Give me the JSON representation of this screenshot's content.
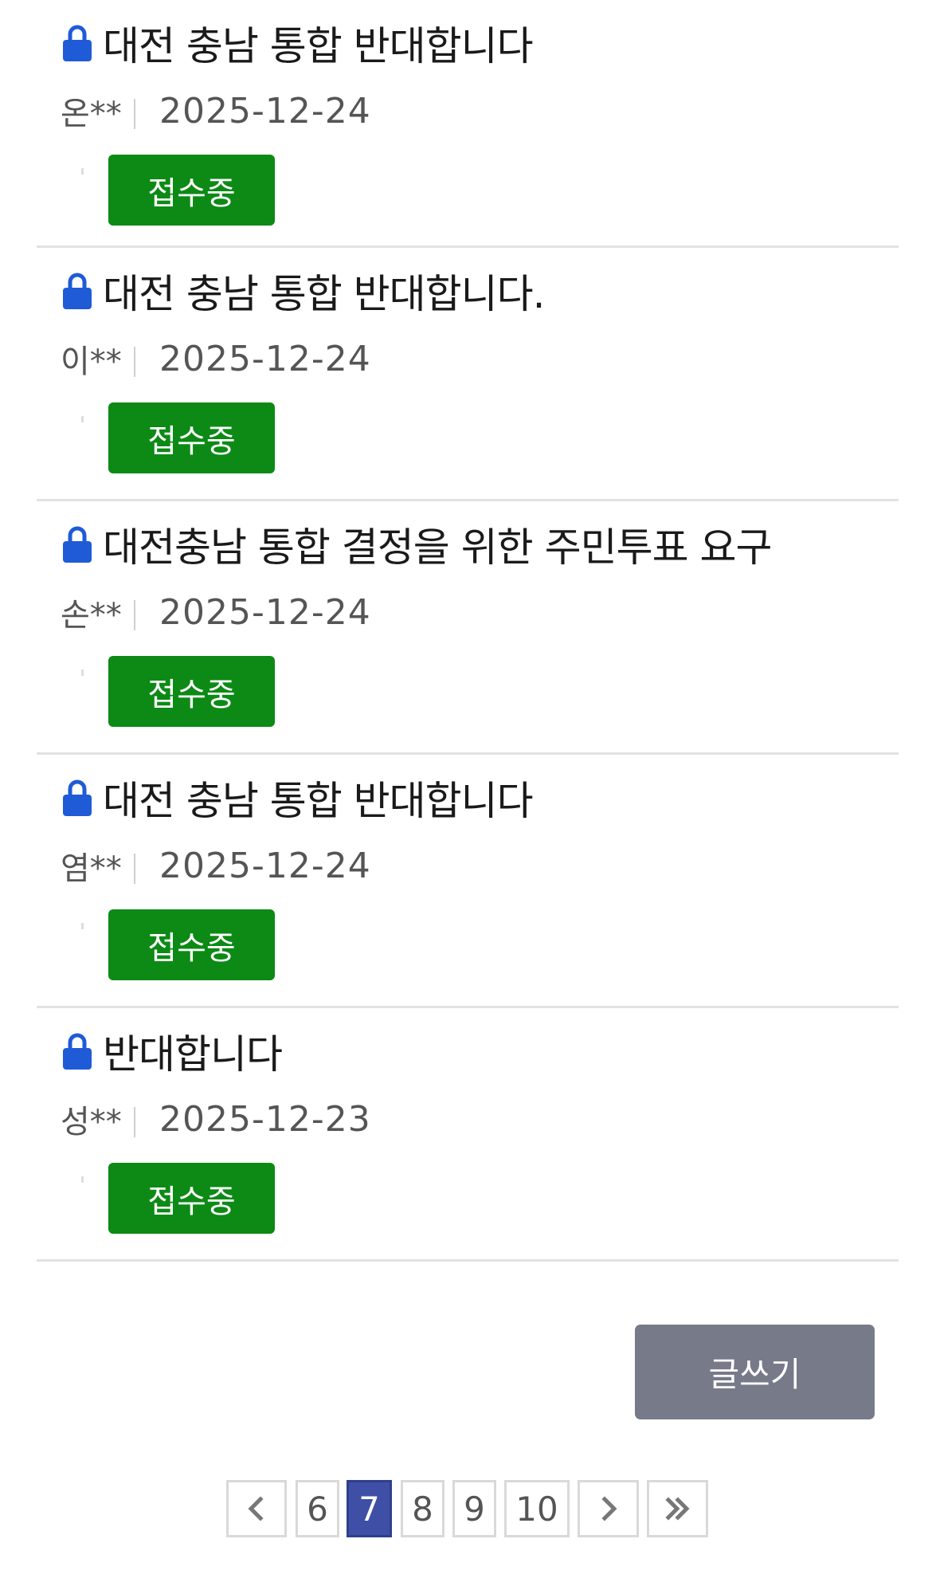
{
  "posts": [
    {
      "title": "대전 충남 통합 반대합니다",
      "author": "온**",
      "date": "2025-12-24",
      "status": "접수중"
    },
    {
      "title": "대전 충남 통합 반대합니다.",
      "author": "이**",
      "date": "2025-12-24",
      "status": "접수중"
    },
    {
      "title": "대전충남 통합 결정을 위한 주민투표 요구",
      "author": "손**",
      "date": "2025-12-24",
      "status": "접수중"
    },
    {
      "title": "대전 충남 통합 반대합니다",
      "author": "염**",
      "date": "2025-12-24",
      "status": "접수중"
    },
    {
      "title": "반대합니다",
      "author": "성**",
      "date": "2025-12-23",
      "status": "접수중"
    }
  ],
  "write_label": "글쓰기",
  "pagination": {
    "pages": [
      "6",
      "7",
      "8",
      "9",
      "10"
    ],
    "current": "7"
  },
  "colors": {
    "lock": "#1f5bd6",
    "status_green": "#0c8a15",
    "write_button": "#777a89",
    "active_page": "#3f4fa6"
  }
}
